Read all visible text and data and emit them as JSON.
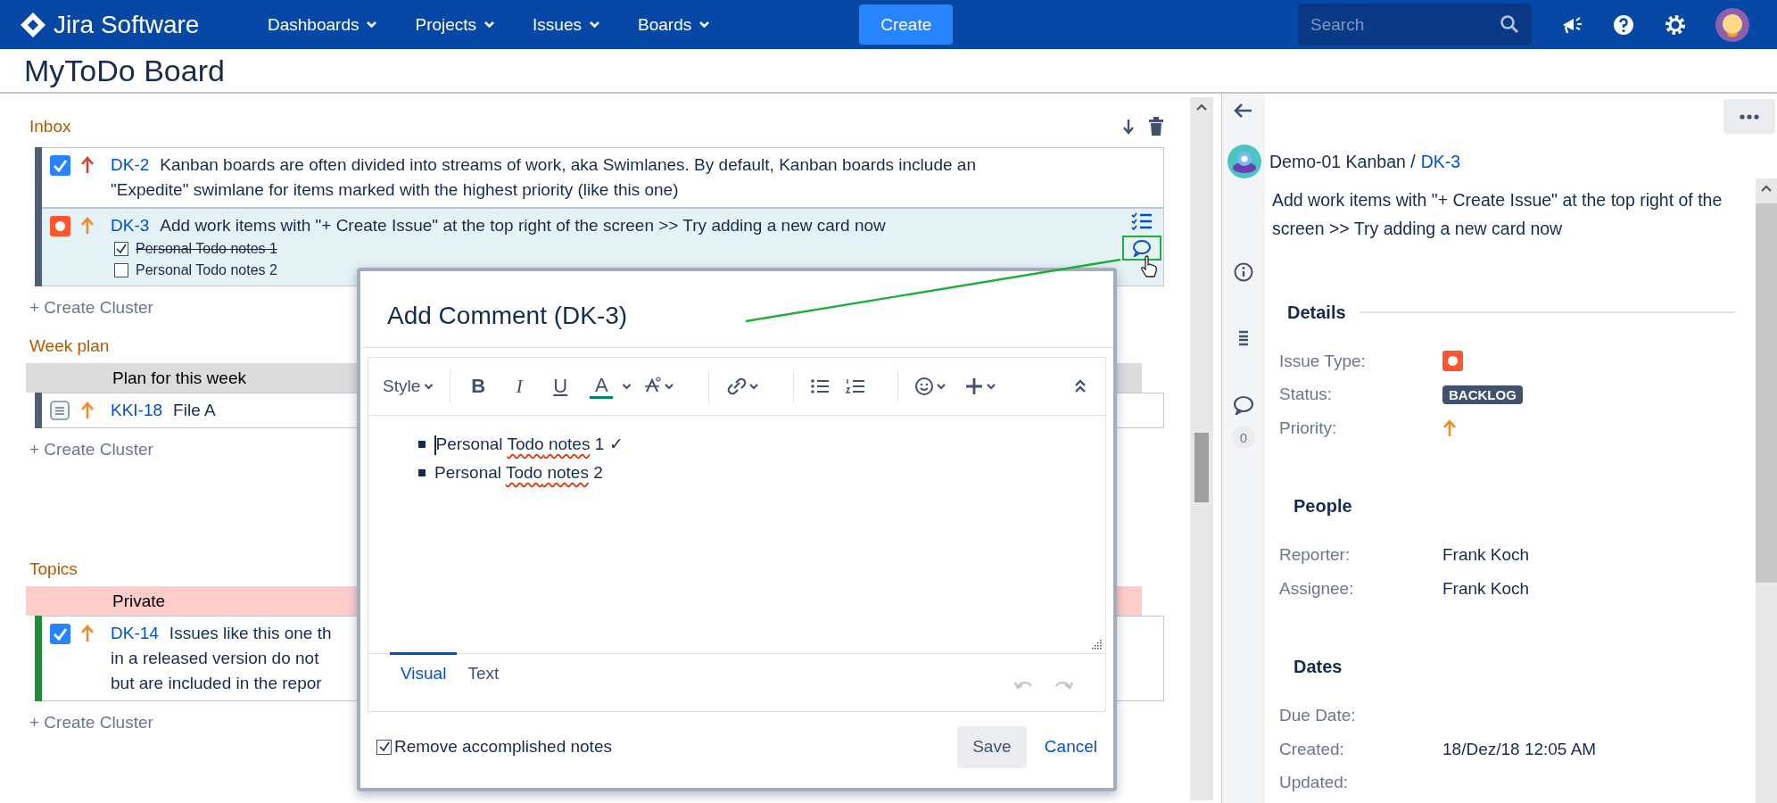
{
  "header": {
    "product": "Jira Software",
    "nav": [
      {
        "label": "Dashboards"
      },
      {
        "label": "Projects"
      },
      {
        "label": "Issues"
      },
      {
        "label": "Boards"
      }
    ],
    "create_button": "Create",
    "search": {
      "placeholder": "Search"
    }
  },
  "board": {
    "title": "MyToDo Board",
    "clusters": [
      {
        "title": "Inbox",
        "actions": true,
        "create_label": "+ Create Cluster",
        "issues": [
          {
            "key": "DK-2",
            "kind": "done",
            "priority": {
              "color": "#d04437"
            },
            "color": "#505f79",
            "selected": false,
            "lines": [
              "Kanban boards are often divided into streams of work, aka Swimlanes. By default, Kanban boards include an",
              "\"Expedite\" swimlane for items marked with the highest priority (like this one)"
            ]
          },
          {
            "key": "DK-3",
            "kind": "bug",
            "priority": {
              "color": "#f08a24"
            },
            "color": "#505f79",
            "selected": true,
            "lines": [
              "Add work items with \"+ Create Issue\" at the top right of the screen >> Try adding a new card now"
            ],
            "notes": [
              {
                "text": "Personal Todo notes 1",
                "checked": true
              },
              {
                "text": "Personal Todo notes 2",
                "checked": false
              }
            ]
          }
        ]
      },
      {
        "title": "Week plan",
        "create_label": "+ Create Cluster",
        "group": {
          "label": "Plan for this week",
          "color": "#dcdcdc"
        },
        "issues": [
          {
            "key": "KKI-18",
            "kind": "doc",
            "priority": {
              "color": "#f08a24"
            },
            "color": "#505f79",
            "selected": false,
            "lines": [
              "File A"
            ]
          }
        ]
      },
      {
        "title": "Topics",
        "create_label": "+ Create Cluster",
        "group": {
          "label": "Private",
          "color": "#ffcccc"
        },
        "issues": [
          {
            "key": "DK-14",
            "kind": "done",
            "priority": {
              "color": "#f08a24"
            },
            "color": "#1f8c3a",
            "selected": false,
            "lines": [
              "Issues like this one th",
              "in a released version do not",
              "but are included in the repor"
            ]
          }
        ]
      }
    ]
  },
  "comment_dialog": {
    "title": "Add Comment (DK-3)",
    "style_menu": "Style",
    "format_buttons": [
      {
        "kind": "bold",
        "label": "B"
      },
      {
        "kind": "italic",
        "label": "I"
      },
      {
        "kind": "underline",
        "label": "U"
      },
      {
        "kind": "color",
        "label": "A"
      }
    ],
    "bullets": [
      [
        {
          "text": "Personal ",
          "misspelled": false
        },
        {
          "text": "Todo",
          "misspelled": true
        },
        {
          "text": " notes",
          "misspelled": true
        },
        {
          "text": " 1 ✓",
          "misspelled": false
        }
      ],
      [
        {
          "text": "Personal ",
          "misspelled": false
        },
        {
          "text": "Todo",
          "misspelled": true
        },
        {
          "text": " notes",
          "misspelled": true
        },
        {
          "text": " 2",
          "misspelled": false
        }
      ]
    ],
    "tabs": [
      {
        "label": "Visual",
        "selected": true
      },
      {
        "label": "Text",
        "selected": false
      }
    ],
    "option": {
      "label": "Remove accomplished notes",
      "checked": true
    },
    "save": "Save",
    "cancel": "Cancel"
  },
  "issue_panel": {
    "comment_count": "0",
    "project": "Demo-01 Kanban /",
    "key": "DK-3",
    "summary": "Add work items with \"+ Create Issue\" at the top right of the screen >> Try adding a new card now",
    "sections": [
      {
        "title": "Details",
        "divider": true,
        "fields": [
          {
            "label": "Issue Type:",
            "kind": "issue-type"
          },
          {
            "label": "Status:",
            "kind": "status",
            "value": "BACKLOG"
          },
          {
            "label": "Priority:",
            "kind": "priority",
            "priority": {
              "color": "#f08a24"
            }
          }
        ]
      },
      {
        "title": "People",
        "fields": [
          {
            "label": "Reporter:",
            "kind": "text",
            "value": "Frank Koch"
          },
          {
            "label": "Assignee:",
            "kind": "text",
            "value": "Frank Koch"
          }
        ]
      },
      {
        "title": "Dates",
        "fields": [
          {
            "label": "Due Date:",
            "kind": "text"
          },
          {
            "label": "Created:",
            "kind": "text",
            "value": "18/Dez/18 12:05 AM"
          },
          {
            "label": "Updated:",
            "kind": "text"
          }
        ]
      }
    ]
  }
}
